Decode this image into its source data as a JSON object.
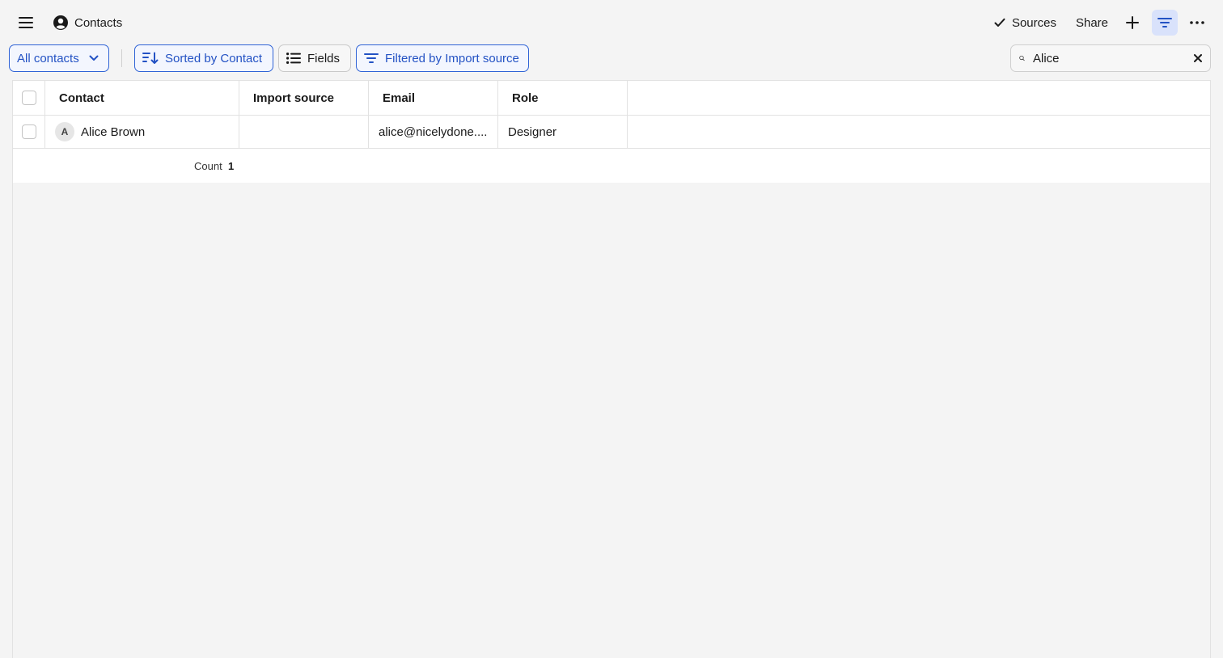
{
  "header": {
    "title": "Contacts",
    "sources_label": "Sources",
    "share_label": "Share"
  },
  "toolbar": {
    "view_label": "All contacts",
    "sort_label": "Sorted by Contact",
    "fields_label": "Fields",
    "filter_label": "Filtered by Import source"
  },
  "search": {
    "value": "Alice"
  },
  "table": {
    "columns": [
      "Contact",
      "Import source",
      "Email",
      "Role"
    ],
    "rows": [
      {
        "avatar_initial": "A",
        "contact": "Alice Brown",
        "import_source": "",
        "email": "alice@nicelydone....",
        "role": "Designer"
      }
    ],
    "footer": {
      "count_label": "Count",
      "count_value": "1"
    }
  },
  "colors": {
    "accent": "#2352c4",
    "accent_bg": "#d9e2fb",
    "background": "#f4f4f4"
  },
  "icons": {
    "menu": "hamburger-icon",
    "title": "user-circle-icon",
    "sources": "check-icon",
    "add": "plus-icon",
    "filter": "filter-icon",
    "more": "more-horizontal-icon",
    "view_dropdown": "chevron-down-icon",
    "sort": "sort-icon",
    "fields": "list-icon",
    "search": "search-icon",
    "clear": "close-icon"
  }
}
